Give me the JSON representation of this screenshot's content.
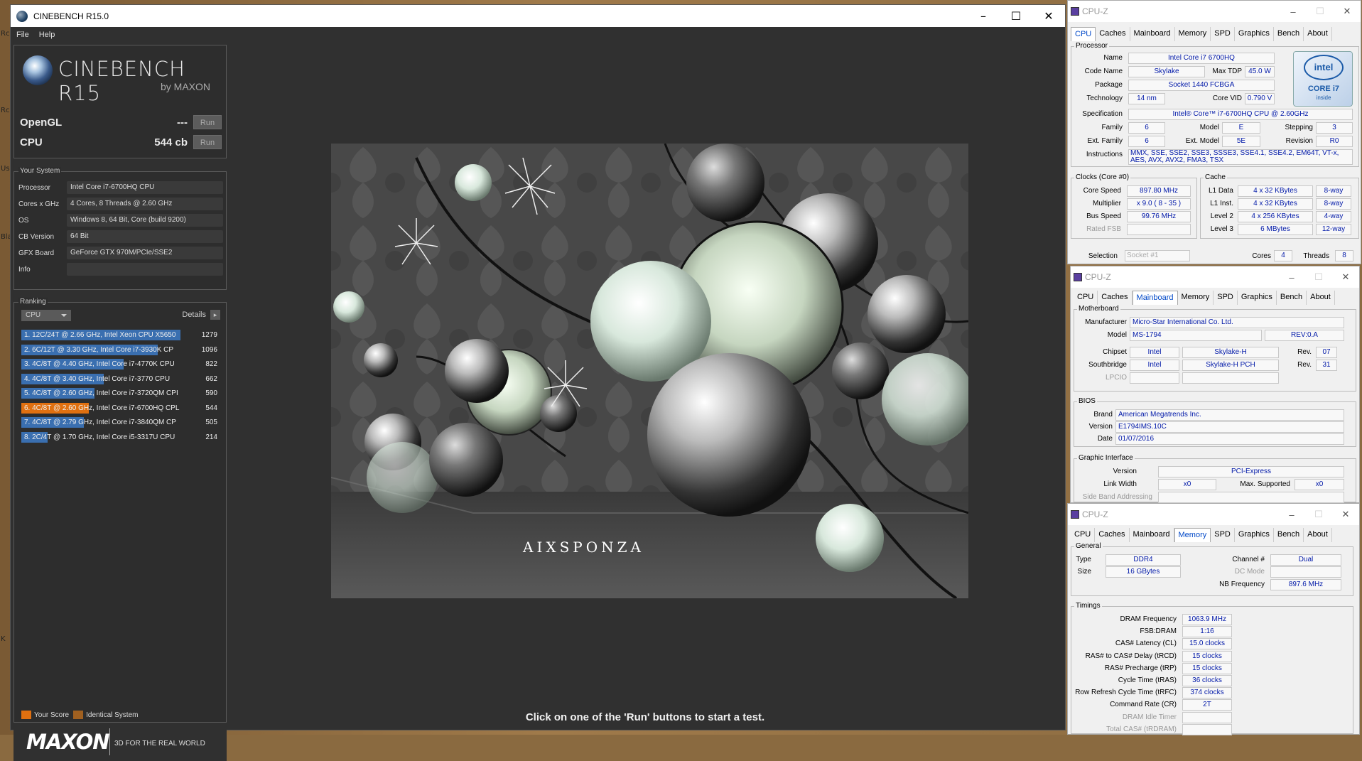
{
  "desktop": {
    "edge_labels": [
      "Rc",
      "Rc",
      "Us",
      "Bla",
      "K"
    ]
  },
  "cinebench": {
    "title": "CINEBENCH R15.0",
    "menu": [
      "File",
      "Help"
    ],
    "logo": {
      "name": "CINEBENCH R15",
      "sub": "by MAXON"
    },
    "opengl": {
      "label": "OpenGL",
      "value": "---",
      "run": "Run"
    },
    "cpu": {
      "label": "CPU",
      "value": "544 cb",
      "run": "Run"
    },
    "your_system": {
      "title": "Your System",
      "rows": [
        {
          "k": "Processor",
          "v": "Intel Core i7-6700HQ CPU"
        },
        {
          "k": "Cores x GHz",
          "v": "4 Cores, 8 Threads @ 2.60 GHz"
        },
        {
          "k": "OS",
          "v": "Windows 8, 64 Bit, Core (build 9200)"
        },
        {
          "k": "CB Version",
          "v": "64 Bit"
        },
        {
          "k": "GFX Board",
          "v": "GeForce GTX 970M/PCIe/SSE2"
        },
        {
          "k": "Info",
          "v": ""
        }
      ]
    },
    "ranking": {
      "title": "Ranking",
      "select": "CPU",
      "details": "Details",
      "rows": [
        {
          "text": "1. 12C/24T @ 2.66 GHz, Intel Xeon CPU X5650",
          "score": "1279",
          "fill": 1.0,
          "color": "#3a6fb0"
        },
        {
          "text": "2. 6C/12T @ 3.30 GHz,  Intel Core i7-3930K CP",
          "score": "1096",
          "fill": 0.857,
          "color": "#3a6fb0"
        },
        {
          "text": "3. 4C/8T @ 4.40 GHz, Intel Core i7-4770K CPU",
          "score": "822",
          "fill": 0.643,
          "color": "#3a6fb0"
        },
        {
          "text": "4. 4C/8T @ 3.40 GHz,  Intel Core i7-3770 CPU",
          "score": "662",
          "fill": 0.518,
          "color": "#3a6fb0"
        },
        {
          "text": "5. 4C/8T @ 2.60 GHz, Intel Core i7-3720QM CPI",
          "score": "590",
          "fill": 0.461,
          "color": "#3a6fb0"
        },
        {
          "text": "6. 4C/8T @ 2.60 GHz, Intel Core i7-6700HQ CPL",
          "score": "544",
          "fill": 0.425,
          "color": "#e07010"
        },
        {
          "text": "7. 4C/8T @ 2.79 GHz,  Intel Core i7-3840QM CP",
          "score": "505",
          "fill": 0.395,
          "color": "#3a6fb0"
        },
        {
          "text": "8. 2C/4T @ 1.70 GHz,  Intel Core i5-3317U CPU",
          "score": "214",
          "fill": 0.167,
          "color": "#3a6fb0"
        }
      ],
      "legend": {
        "your": "Your Score",
        "identical": "Identical System",
        "your_color": "#e07010",
        "identical_color": "#a06020"
      }
    },
    "footer": {
      "brand": "MAXON",
      "tagline": "3D FOR THE REAL WORLD"
    },
    "render_logo": "AIXSPONZA",
    "status": "Click on one of the 'Run' buttons to start a test."
  },
  "cpuz_cpu": {
    "title": "CPU-Z",
    "tabs": [
      "CPU",
      "Caches",
      "Mainboard",
      "Memory",
      "SPD",
      "Graphics",
      "Bench",
      "About"
    ],
    "active": "CPU",
    "processor": "Processor",
    "name_l": "Name",
    "name": "Intel Core i7 6700HQ",
    "code_l": "Code Name",
    "code": "Skylake",
    "tdp_l": "Max TDP",
    "tdp": "45.0 W",
    "pkg_l": "Package",
    "pkg": "Socket 1440 FCBGA",
    "tech_l": "Technology",
    "tech": "14 nm",
    "vid_l": "Core VID",
    "vid": "0.790 V",
    "spec_l": "Specification",
    "spec": "Intel® Core™ i7-6700HQ CPU @ 2.60GHz",
    "fam_l": "Family",
    "fam": "6",
    "model_l": "Model",
    "model": "E",
    "step_l": "Stepping",
    "step": "3",
    "efam_l": "Ext. Family",
    "efam": "6",
    "emod_l": "Ext. Model",
    "emod": "5E",
    "rev_l": "Revision",
    "rev": "R0",
    "instr_l": "Instructions",
    "instr": "MMX, SSE, SSE2, SSE3, SSSE3, SSE4.1, SSE4.2, EM64T, VT-x, AES, AVX, AVX2, FMA3, TSX",
    "clocks": "Clocks (Core #0)",
    "cs_l": "Core Speed",
    "cs": "897.80 MHz",
    "mul_l": "Multiplier",
    "mul": "x 9.0 ( 8 - 35 )",
    "bus_l": "Bus Speed",
    "bus": "99.76 MHz",
    "fsb_l": "Rated FSB",
    "cache": "Cache",
    "l1d_l": "L1 Data",
    "l1d": "4 x 32 KBytes",
    "l1d_w": "8-way",
    "l1i_l": "L1 Inst.",
    "l1i": "4 x 32 KBytes",
    "l1i_w": "8-way",
    "l2_l": "Level 2",
    "l2": "4 x 256 KBytes",
    "l2_w": "4-way",
    "l3_l": "Level 3",
    "l3": "6 MBytes",
    "l3_w": "12-way",
    "sel_l": "Selection",
    "sel": "Socket #1",
    "cores_l": "Cores",
    "cores": "4",
    "thr_l": "Threads",
    "thr": "8",
    "badge_brand": "intel",
    "badge_line": "CORE i7",
    "badge_inside": "inside"
  },
  "cpuz_mb": {
    "title": "CPU-Z",
    "tabs": [
      "CPU",
      "Caches",
      "Mainboard",
      "Memory",
      "SPD",
      "Graphics",
      "Bench",
      "About"
    ],
    "motherboard": "Motherboard",
    "man_l": "Manufacturer",
    "man": "Micro-Star International Co. Ltd.",
    "model_l": "Model",
    "model": "MS-1794",
    "modrev": "REV:0.A",
    "chip_l": "Chipset",
    "chip_v": "Intel",
    "chip_n": "Skylake-H",
    "chip_rl": "Rev.",
    "chip_r": "07",
    "sb_l": "Southbridge",
    "sb_v": "Intel",
    "sb_n": "Skylake-H PCH",
    "sb_rl": "Rev.",
    "sb_r": "31",
    "lpc_l": "LPCIO",
    "bios": "BIOS",
    "brand_l": "Brand",
    "brand": "American Megatrends Inc.",
    "ver_l": "Version",
    "ver": "E1794IMS.10C",
    "date_l": "Date",
    "date": "01/07/2016",
    "gi": "Graphic Interface",
    "gv_l": "Version",
    "gv": "PCI-Express",
    "lw_l": "Link Width",
    "lw": "x0",
    "ms_l": "Max. Supported",
    "ms": "x0",
    "sba_l": "Side Band Addressing"
  },
  "cpuz_mem": {
    "title": "CPU-Z",
    "tabs": [
      "CPU",
      "Caches",
      "Mainboard",
      "Memory",
      "SPD",
      "Graphics",
      "Bench",
      "About"
    ],
    "general": "General",
    "type_l": "Type",
    "type": "DDR4",
    "ch_l": "Channel #",
    "ch": "Dual",
    "size_l": "Size",
    "size": "16 GBytes",
    "dc_l": "DC Mode",
    "nb_l": "NB Frequency",
    "nb": "897.6 MHz",
    "timings": "Timings",
    "rows": [
      {
        "l": "DRAM Frequency",
        "v": "1063.9 MHz"
      },
      {
        "l": "FSB:DRAM",
        "v": "1:16"
      },
      {
        "l": "CAS# Latency (CL)",
        "v": "15.0 clocks"
      },
      {
        "l": "RAS# to CAS# Delay (tRCD)",
        "v": "15 clocks"
      },
      {
        "l": "RAS# Precharge (tRP)",
        "v": "15 clocks"
      },
      {
        "l": "Cycle Time (tRAS)",
        "v": "36 clocks"
      },
      {
        "l": "Row Refresh Cycle Time (tRFC)",
        "v": "374 clocks"
      },
      {
        "l": "Command Rate (CR)",
        "v": "2T"
      },
      {
        "l": "DRAM Idle Timer",
        "v": ""
      },
      {
        "l": "Total CAS# (tRDRAM)",
        "v": ""
      }
    ]
  }
}
